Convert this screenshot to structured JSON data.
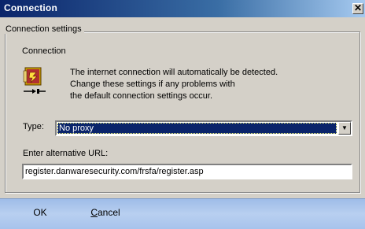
{
  "window": {
    "title": "Connection",
    "close_glyph": "✕",
    "close_icon": "close-icon"
  },
  "group": {
    "legend": "Connection settings",
    "section_title": "Connection",
    "icon": "network-connection-icon",
    "description": [
      "The internet connection will automatically be detected.",
      "Change these settings if any problems with",
      "the default connection settings occur."
    ]
  },
  "type": {
    "label": "Type:",
    "selected": "No proxy",
    "arrow_icon": "dropdown-arrow-icon"
  },
  "url": {
    "label": "Enter alternative URL:",
    "value": "register.danwaresecurity.com/frsfa/register.asp"
  },
  "footer": {
    "ok_label": "OK",
    "cancel_rest": "ancel",
    "cancel_mnemonic": "C"
  },
  "colors": {
    "titlebar_start": "#0a246a",
    "titlebar_end": "#a6caf0",
    "selection": "#0a246a",
    "footer": "#b8cff0",
    "face": "#d4d0c8"
  }
}
